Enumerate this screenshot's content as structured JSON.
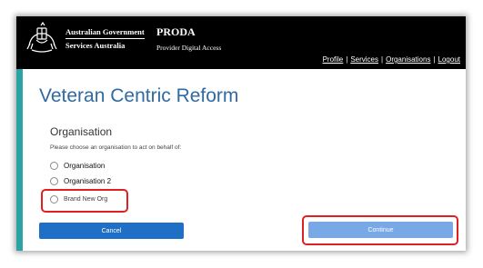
{
  "header": {
    "gov_line1": "Australian Government",
    "gov_line2": "Services Australia",
    "app_name": "PRODA",
    "app_subtitle": "Provider Digital Access",
    "nav": [
      "Profile",
      "Services",
      "Organisations",
      "Logout"
    ],
    "nav_separator": "|"
  },
  "page": {
    "title": "Veteran Centric Reform"
  },
  "organisation": {
    "heading": "Organisation",
    "instruction": "Please choose an organisation to act on behalf of:",
    "options": [
      "Organisation",
      "Organisation 2",
      "Brand New Org"
    ],
    "selected": null
  },
  "buttons": {
    "cancel": "Cancel",
    "continue": "Continue"
  },
  "colors": {
    "header_bg": "#000000",
    "accent_stripe": "#2ca4a6",
    "title": "#2f6aa3",
    "cancel_button": "#1f6fc6",
    "continue_button": "#79a8e6",
    "highlight": "#e02020"
  },
  "icons": {
    "logo": "australian-coat-of-arms-icon"
  }
}
